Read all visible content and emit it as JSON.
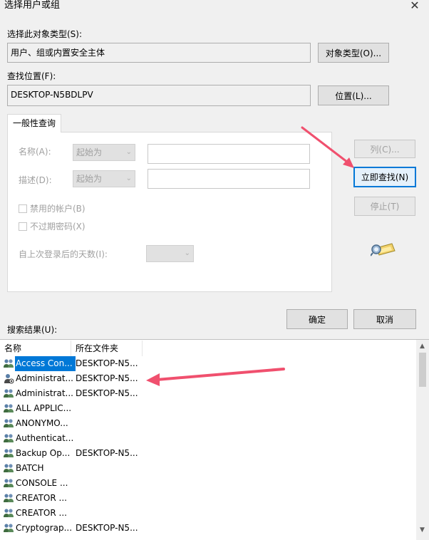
{
  "window": {
    "title": "选择用户或组",
    "close_glyph": "✕"
  },
  "object_type": {
    "label": "选择此对象类型(S):",
    "value": "用户、组或内置安全主体",
    "button": "对象类型(O)..."
  },
  "location": {
    "label": "查找位置(F):",
    "value": "DESKTOP-N5BDLPV",
    "button": "位置(L)..."
  },
  "query": {
    "tab": "一般性查询",
    "name_label": "名称(A):",
    "name_mode": "起始为",
    "desc_label": "描述(D):",
    "desc_mode": "起始为",
    "disabled_accounts": "禁用的帐户(B)",
    "no_expire_pwd": "不过期密码(X)",
    "days_label": "自上次登录后的天数(I):"
  },
  "side_buttons": {
    "columns": "列(C)...",
    "find_now": "立即查找(N)",
    "stop": "停止(T)"
  },
  "dialog_buttons": {
    "ok": "确定",
    "cancel": "取消"
  },
  "results": {
    "label": "搜索结果(U):",
    "columns": [
      "名称",
      "所在文件夹"
    ],
    "rows": [
      {
        "name": "Access Con...",
        "folder": "DESKTOP-N5...",
        "icon": "group-icon",
        "selected": true
      },
      {
        "name": "Administrat...",
        "folder": "DESKTOP-N5...",
        "icon": "user-icon",
        "selected": false
      },
      {
        "name": "Administrat...",
        "folder": "DESKTOP-N5...",
        "icon": "group-icon",
        "selected": false
      },
      {
        "name": "ALL APPLIC...",
        "folder": "",
        "icon": "group-icon",
        "selected": false
      },
      {
        "name": "ANONYMO...",
        "folder": "",
        "icon": "group-icon",
        "selected": false
      },
      {
        "name": "Authenticat...",
        "folder": "",
        "icon": "group-icon",
        "selected": false
      },
      {
        "name": "Backup Op...",
        "folder": "DESKTOP-N5...",
        "icon": "group-icon",
        "selected": false
      },
      {
        "name": "BATCH",
        "folder": "",
        "icon": "group-icon",
        "selected": false
      },
      {
        "name": "CONSOLE ...",
        "folder": "",
        "icon": "group-icon",
        "selected": false
      },
      {
        "name": "CREATOR ...",
        "folder": "",
        "icon": "group-icon",
        "selected": false
      },
      {
        "name": "CREATOR ...",
        "folder": "",
        "icon": "group-icon",
        "selected": false
      },
      {
        "name": "Cryptograp...",
        "folder": "DESKTOP-N5...",
        "icon": "group-icon",
        "selected": false
      }
    ]
  },
  "colors": {
    "accent": "#0078d7",
    "annotation_arrow": "#f0506e"
  }
}
